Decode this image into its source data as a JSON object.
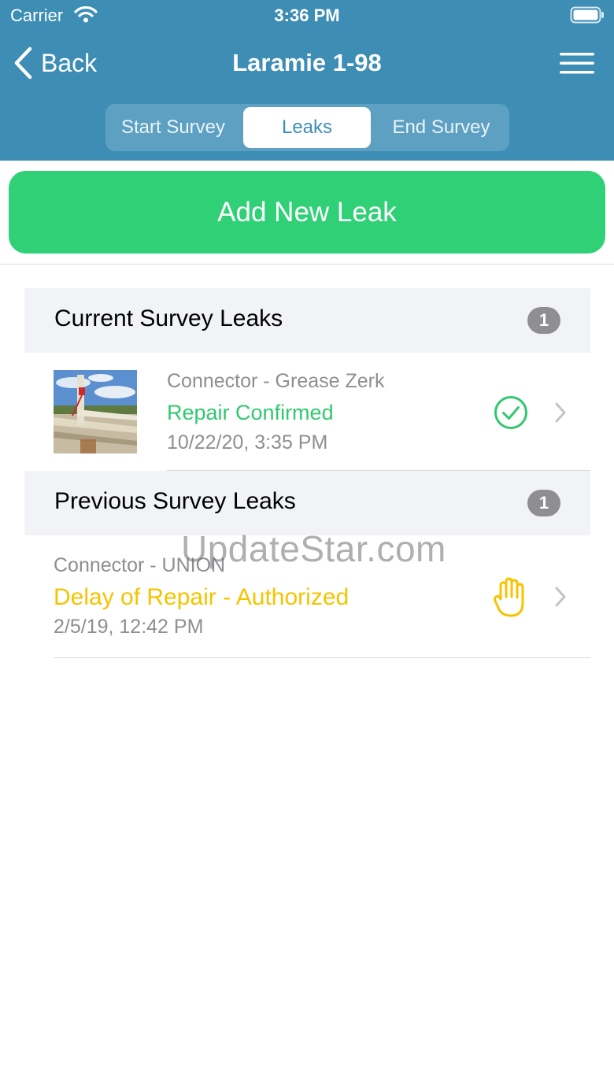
{
  "status_bar": {
    "carrier": "Carrier",
    "time": "3:36 PM"
  },
  "nav": {
    "back_label": "Back",
    "title": "Laramie 1-98"
  },
  "tabs": [
    {
      "label": "Start Survey"
    },
    {
      "label": "Leaks",
      "selected": true
    },
    {
      "label": "End Survey"
    }
  ],
  "add_button": {
    "label": "Add New Leak"
  },
  "current_section": {
    "title": "Current Survey Leaks",
    "count": "1",
    "items": [
      {
        "component": "Connector - Grease Zerk",
        "status": "Repair Confirmed",
        "timestamp": "10/22/20, 3:35 PM",
        "status_color": "#30c96f",
        "icon": "check-circle-icon"
      }
    ]
  },
  "previous_section": {
    "title": "Previous Survey Leaks",
    "count": "1",
    "items": [
      {
        "component": "Connector - UNION",
        "status": "Delay of Repair - Authorized",
        "timestamp": "2/5/19, 12:42 PM",
        "status_color": "#f5c400",
        "icon": "hand-stop-icon"
      }
    ]
  },
  "watermark": "UpdateStar.com",
  "colors": {
    "header": "#3d8db5",
    "accent_green": "#30d176",
    "badge": "#8e8e93"
  }
}
